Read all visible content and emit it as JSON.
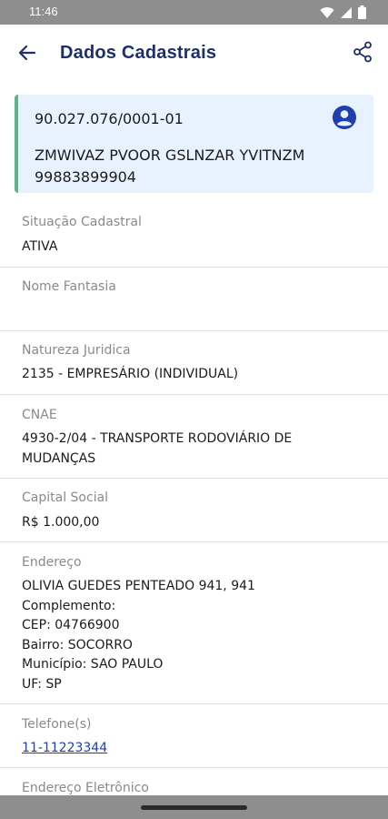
{
  "status_bar": {
    "time": "11:46",
    "icons": [
      "wifi-icon",
      "signal-icon",
      "battery-icon"
    ]
  },
  "app_bar": {
    "title": "Dados Cadastrais",
    "back_icon": "back-arrow-icon",
    "share_icon": "share-icon"
  },
  "company_card": {
    "cnpj": "90.027.076/0001-01",
    "name": "ZMWIVAZ PVOOR GSLNZAR YVITNZM",
    "code": "99883899904",
    "avatar_icon": "account-circle-icon",
    "accent_color": "#5fb38a",
    "background_color": "#e8f2fe"
  },
  "fields": {
    "situacao": {
      "label": "Situação Cadastral",
      "value": "ATIVA"
    },
    "nome_fantasia": {
      "label": "Nome Fantasia",
      "value": ""
    },
    "natureza": {
      "label": "Natureza Juridica",
      "value": "2135 - EMPRESÁRIO (INDIVIDUAL)"
    },
    "cnae": {
      "label": "CNAE",
      "value_lines": [
        "4930-2/04 - TRANSPORTE RODOVIÁRIO DE",
        "MUDANÇAS"
      ]
    },
    "capital": {
      "label": "Capital Social",
      "value": "R$ 1.000,00"
    },
    "endereco": {
      "label": "Endereço",
      "value_lines": [
        "OLIVIA GUEDES PENTEADO 941, 941",
        "Complemento:",
        "CEP: 04766900",
        "Bairro: SOCORRO",
        "Município: SAO PAULO",
        "UF: SP"
      ]
    },
    "telefone": {
      "label": "Telefone(s)",
      "value": "11-11223344"
    },
    "email": {
      "label": "Endereço Eletrônico"
    }
  },
  "colors": {
    "title": "#1f2f6b",
    "link": "#1f3fb0",
    "label": "#8a8a8a",
    "avatar": "#1f3fb0"
  }
}
